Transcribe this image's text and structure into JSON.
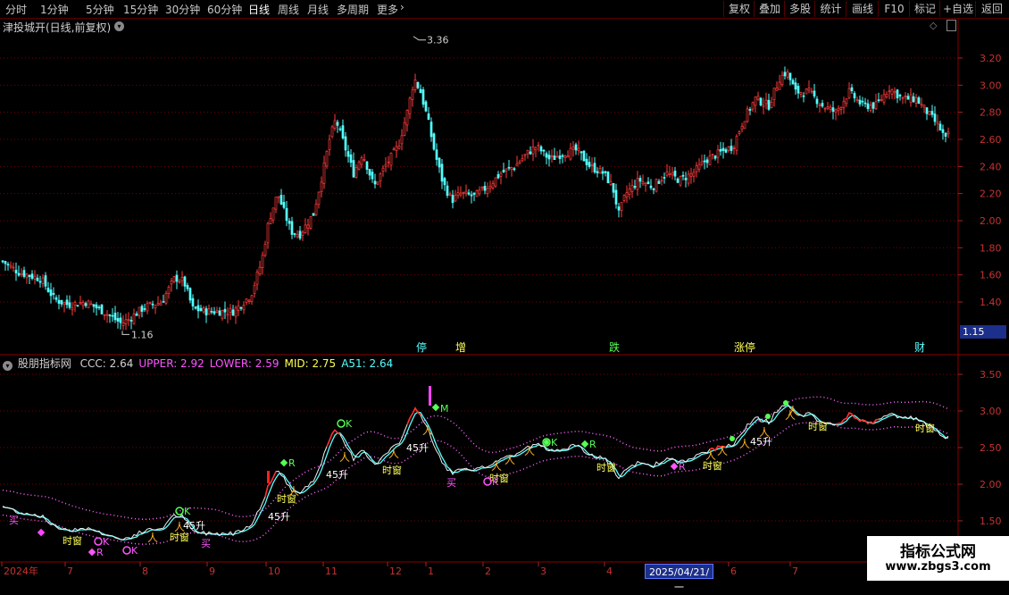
{
  "toolbar": {
    "periods": [
      "分时",
      "1分钟",
      "5分钟",
      "15分钟",
      "30分钟",
      "60分钟",
      "日线",
      "周线",
      "月线",
      "多周期",
      "更多"
    ],
    "active_period": "日线",
    "right_buttons": [
      "复权",
      "叠加",
      "多股",
      "统计",
      "画线",
      "F10",
      "标记",
      "+自选",
      "返回"
    ]
  },
  "main_panel": {
    "title": "津投城开(日线,前复权)",
    "high_label": "3.36",
    "low_label": "1.16",
    "price_axis": [
      "3.20",
      "3.00",
      "2.80",
      "2.60",
      "2.40",
      "2.20",
      "2.00",
      "1.80",
      "1.60",
      "1.40"
    ],
    "current_price_tag": "1.15",
    "event_markers": [
      "停",
      "增",
      "跌",
      "涨停",
      "财"
    ]
  },
  "indicator_panel": {
    "name": "股朋指标网",
    "values": [
      {
        "label": "CCC",
        "value": "2.64",
        "color": "#d2d2d2"
      },
      {
        "label": "UPPER",
        "value": "2.92",
        "color": "#ff55ff"
      },
      {
        "label": "LOWER",
        "value": "2.59",
        "color": "#ff55ff"
      },
      {
        "label": "MID",
        "value": "2.75",
        "color": "#ffff55"
      },
      {
        "label": "A51",
        "value": "2.64",
        "color": "#55ffff"
      }
    ],
    "axis": [
      "3.50",
      "3.00",
      "2.50",
      "2.00",
      "1.50"
    ],
    "signal_labels": {
      "shichuang": "时窗",
      "sheng": "45升",
      "mai": "买",
      "ok": "K",
      "r": "R",
      "m": "M"
    }
  },
  "time_axis": {
    "labels": [
      "2024年",
      "7",
      "8",
      "9",
      "10",
      "11",
      "12",
      "1",
      "2",
      "3",
      "4",
      "2025/04/21/一",
      "6",
      "7"
    ]
  },
  "chart_data": {
    "type": "candlestick",
    "title": "津投城开(日线,前复权)",
    "price_range": [
      1.16,
      3.36
    ],
    "highest": 3.36,
    "lowest": 1.16,
    "approx_monthly_close": [
      {
        "period": "2024-06",
        "close": 1.55
      },
      {
        "period": "2024-07",
        "close": 1.35
      },
      {
        "period": "2024-08",
        "close": 1.42
      },
      {
        "period": "2024-09",
        "close": 1.3
      },
      {
        "period": "2024-10",
        "close": 1.95
      },
      {
        "period": "2024-11",
        "close": 2.4
      },
      {
        "period": "2024-12",
        "close": 2.6
      },
      {
        "period": "2025-01",
        "close": 2.15
      },
      {
        "period": "2025-02",
        "close": 2.35
      },
      {
        "period": "2025-03",
        "close": 2.5
      },
      {
        "period": "2025-04",
        "close": 2.1
      },
      {
        "period": "2025-05",
        "close": 2.45
      },
      {
        "period": "2025-06",
        "close": 2.85
      },
      {
        "period": "2025-07",
        "close": 2.9
      },
      {
        "period": "2025-08",
        "close": 2.65
      }
    ],
    "indicator": {
      "CCC": 2.64,
      "UPPER": 2.92,
      "LOWER": 2.59,
      "MID": 2.75,
      "A51": 2.64
    }
  },
  "watermark": {
    "title": "指标公式网",
    "url": "www.zbgs3.com"
  }
}
